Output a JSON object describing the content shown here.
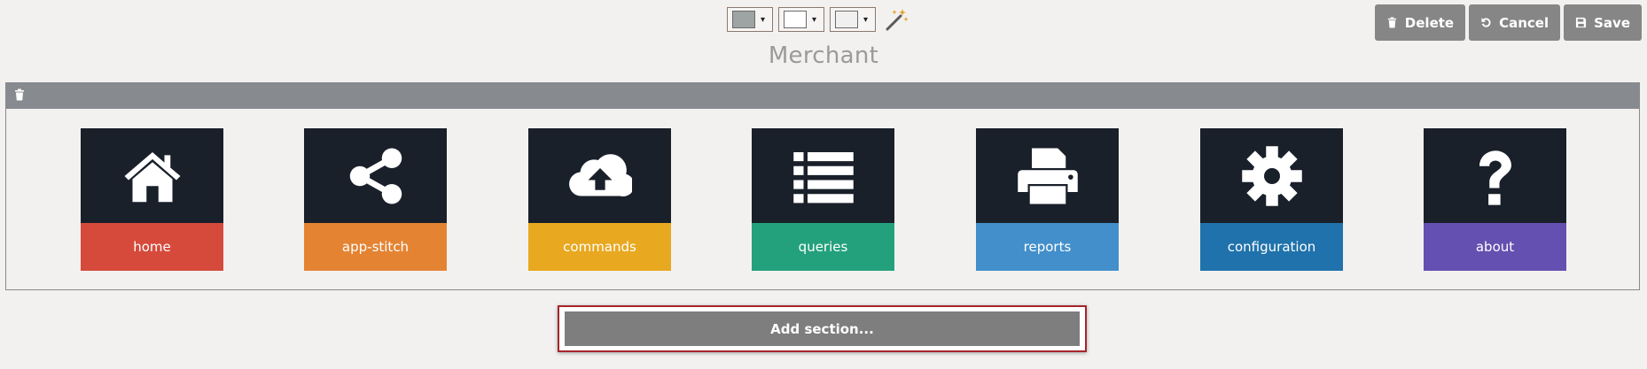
{
  "toolbar": {
    "swatches": [
      {
        "name": "background-color",
        "color": "#9ea3a3"
      },
      {
        "name": "border-color",
        "color": "#ffffff"
      },
      {
        "name": "text-color",
        "color": "#f0f0f0"
      }
    ],
    "caret": "▾"
  },
  "actions": {
    "delete_label": "Delete",
    "cancel_label": "Cancel",
    "save_label": "Save"
  },
  "page": {
    "title": "Merchant"
  },
  "tiles": [
    {
      "label": "home",
      "icon": "home-icon",
      "color": "#d64a3b"
    },
    {
      "label": "app-stitch",
      "icon": "share-icon",
      "color": "#e48433"
    },
    {
      "label": "commands",
      "icon": "cloud-upload-icon",
      "color": "#e8a820"
    },
    {
      "label": "queries",
      "icon": "list-icon",
      "color": "#23a17c"
    },
    {
      "label": "reports",
      "icon": "print-icon",
      "color": "#428fcb"
    },
    {
      "label": "configuration",
      "icon": "gear-icon",
      "color": "#1f72ab"
    },
    {
      "label": "about",
      "icon": "question-icon",
      "color": "#6450b0"
    }
  ],
  "add_section": {
    "label": "Add section..."
  }
}
